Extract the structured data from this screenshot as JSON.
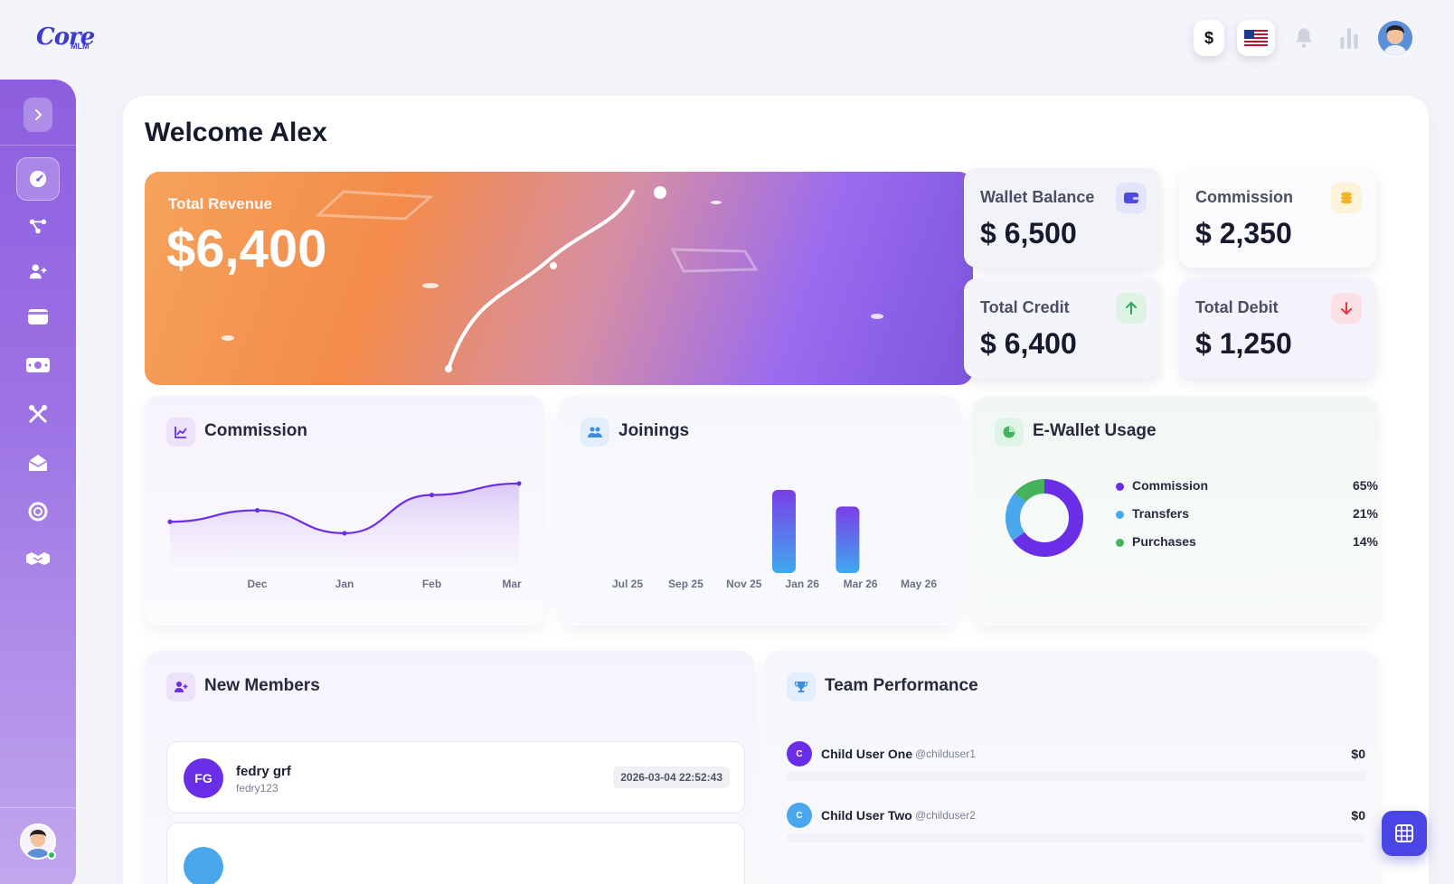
{
  "brand": {
    "logo_main": "Core",
    "logo_sub": "MLM"
  },
  "topbar": {
    "currency_symbol": "$",
    "flag_icon": "us-flag-icon",
    "notification_icon": "bell-icon",
    "stats_icon": "bar-chart-icon"
  },
  "sidebar": {
    "items": [
      {
        "icon": "dashboard-icon",
        "active": true
      },
      {
        "icon": "network-icon"
      },
      {
        "icon": "add-user-icon"
      },
      {
        "icon": "wallet-icon"
      },
      {
        "icon": "money-icon"
      },
      {
        "icon": "tools-icon"
      },
      {
        "icon": "mail-icon"
      },
      {
        "icon": "support-icon"
      },
      {
        "icon": "handshake-icon"
      }
    ]
  },
  "welcome": "Welcome Alex",
  "revenue": {
    "label": "Total Revenue",
    "value": "$6,400"
  },
  "stats": {
    "wallet": {
      "label": "Wallet Balance",
      "value": "$ 6,500",
      "color": "#4c4ce0"
    },
    "commission": {
      "label": "Commission",
      "value": "$ 2,350",
      "color": "#f0b429"
    },
    "credit": {
      "label": "Total Credit",
      "value": "$ 6,400",
      "color": "#2fa65a"
    },
    "debit": {
      "label": "Total Debit",
      "value": "$ 1,250",
      "color": "#e23a3a"
    }
  },
  "commission_card": {
    "title": "Commission",
    "chart_data": {
      "type": "area",
      "categories": [
        "",
        "Dec",
        "Jan",
        "Feb",
        "Mar"
      ],
      "values": [
        60,
        75,
        45,
        95,
        110
      ],
      "xlabel": "",
      "ylabel": ""
    }
  },
  "joinings_card": {
    "title": "Joinings",
    "chart_data": {
      "type": "bar",
      "categories": [
        "Jul 25",
        "Sep 25",
        "Nov 25",
        "Jan 26",
        "Mar 26",
        "May 26"
      ],
      "values": [
        0,
        0,
        0,
        5,
        4,
        0
      ],
      "xlabel": "",
      "ylabel": ""
    }
  },
  "ewallet_card": {
    "title": "E-Wallet Usage",
    "chart_data": {
      "type": "pie",
      "categories": [
        "Commission",
        "Transfers",
        "Purchases"
      ],
      "values": [
        65,
        21,
        14
      ],
      "colors": [
        "#6a2ee6",
        "#4aa7ee",
        "#45b35d"
      ]
    },
    "legend": [
      {
        "name": "Commission",
        "pct": "65%"
      },
      {
        "name": "Transfers",
        "pct": "21%"
      },
      {
        "name": "Purchases",
        "pct": "14%"
      }
    ]
  },
  "new_members": {
    "title": "New Members",
    "list": [
      {
        "initials": "FG",
        "name": "fedry grf",
        "username": "fedry123",
        "date": "2026-03-04 22:52:43",
        "color": "#6a2ee6"
      },
      {
        "initials": "",
        "name": "",
        "username": "",
        "date": "",
        "color": "#4aa7ee"
      }
    ]
  },
  "team_performance": {
    "title": "Team Performance",
    "list": [
      {
        "initial": "C",
        "name": "Child User One",
        "username": "@childuser1",
        "amount": "$0",
        "color": "#6a2ee6"
      },
      {
        "initial": "C",
        "name": "Child User Two",
        "username": "@childuser2",
        "amount": "$0",
        "color": "#4aa7ee"
      }
    ]
  }
}
